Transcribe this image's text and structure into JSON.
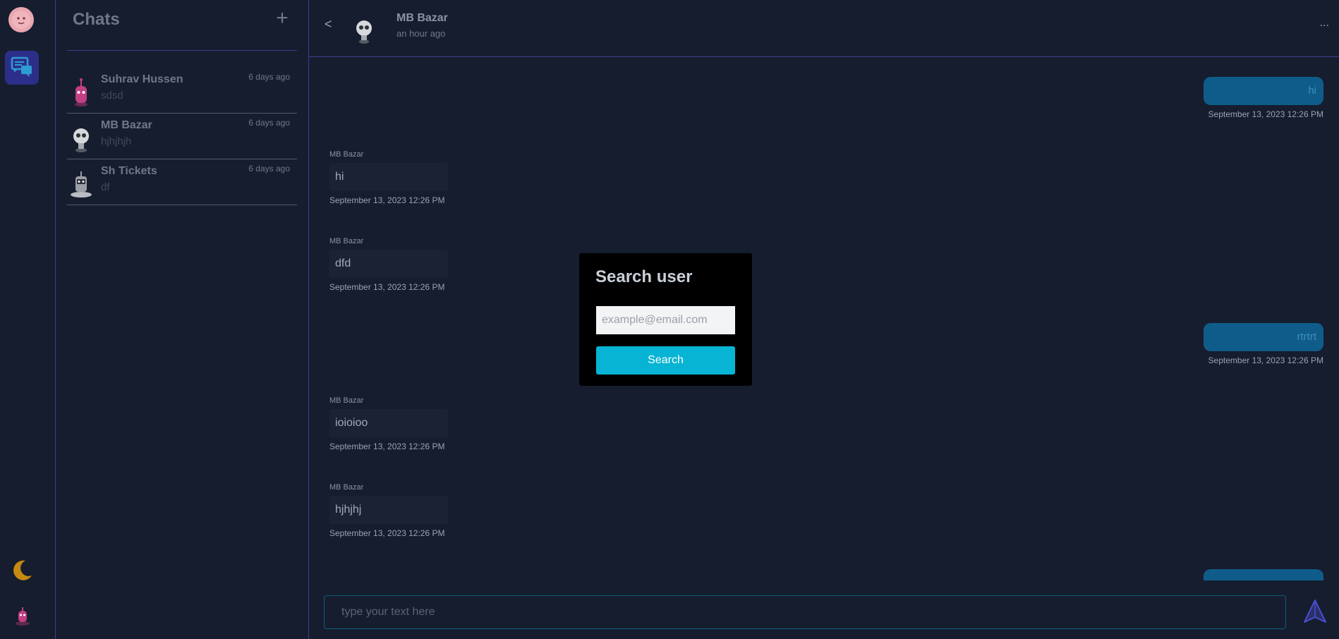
{
  "sidebar": {
    "profile_icon": "user-avatar-icon",
    "chat_icon": "chat-bubbles-icon",
    "theme_icon": "moon-icon",
    "me_icon": "user-avatar-icon"
  },
  "chats": {
    "title": "Chats",
    "add_icon": "plus-icon",
    "items": [
      {
        "name": "Suhrav Hussen",
        "last": "sdsd",
        "time": "6 days ago"
      },
      {
        "name": "MB Bazar",
        "last": "hjhjhjh",
        "time": "6 days ago"
      },
      {
        "name": "Sh Tickets",
        "last": "df",
        "time": "6 days ago"
      }
    ]
  },
  "conversation": {
    "back_label": "<",
    "name": "MB Bazar",
    "status": "an hour ago",
    "more_label": "...",
    "messages": [
      {
        "dir": "sent",
        "text": "hi",
        "time": "September 13, 2023 12:26 PM"
      },
      {
        "dir": "recv",
        "sender": "MB Bazar",
        "text": "hi",
        "time": "September 13, 2023 12:26 PM"
      },
      {
        "dir": "recv",
        "sender": "MB Bazar",
        "text": "dfd",
        "time": "September 13, 2023 12:26 PM"
      },
      {
        "dir": "sent",
        "text": "rtrtrt",
        "time": "September 13, 2023 12:26 PM"
      },
      {
        "dir": "recv",
        "sender": "MB Bazar",
        "text": "ioioioo",
        "time": "September 13, 2023 12:26 PM"
      },
      {
        "dir": "recv",
        "sender": "MB Bazar",
        "text": "hjhjhj",
        "time": "September 13, 2023 12:26 PM"
      },
      {
        "dir": "sent",
        "text": "",
        "time": ""
      }
    ],
    "composer_placeholder": "type your text here",
    "send_icon": "send-arrow-icon"
  },
  "search_modal": {
    "title": "Search user",
    "placeholder": "example@email.com",
    "button_label": "Search"
  },
  "colors": {
    "background": "#161d2e",
    "accent_border": "#3b3f8f",
    "sent_bubble": "#0f5c8a",
    "button": "#08b4d3"
  }
}
